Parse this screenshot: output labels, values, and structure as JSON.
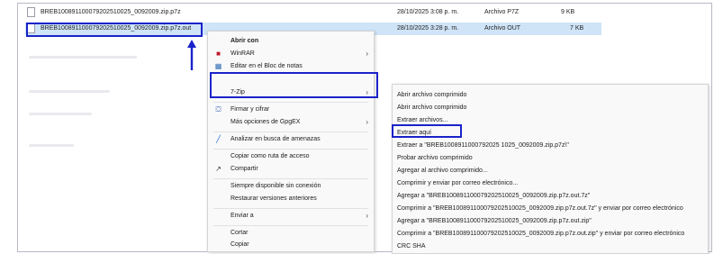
{
  "files": [
    {
      "name": "BREB100891100079202510025_0092009.zip.p7z",
      "date": "28/10/2025 3:08 p. m.",
      "type": "Archivo P7Z",
      "size": "9 KB"
    },
    {
      "name": "BREB100891100079202510025_0092009.zip.p7z.out",
      "date": "28/10/2025 3:28 p. m.",
      "type": "Archivo OUT",
      "size": "7 KB"
    }
  ],
  "context_menu": {
    "open_with": "Abrir con",
    "winrar": "WinRAR",
    "notepad": "Editar en el Bloc de notas",
    "seven_zip": "7-Zip",
    "sign_encrypt": "Firmar y cifrar",
    "gpgex": "Más opciones de GpgEX",
    "scan": "Analizar en busca de amenazas",
    "copy_path": "Copiar como ruta de acceso",
    "share": "Compartir",
    "always_available": "Siempre disponible sin conexión",
    "restore": "Restaurar versiones anteriores",
    "send_to": "Enviar a",
    "cut": "Cortar",
    "copy": "Copiar"
  },
  "submenu": {
    "items": [
      "Abrir archivo comprimido",
      "Abrir archivo comprimido",
      "Extraer archivos...",
      "Extraer aquí",
      "Extraer a \"BREB1008911000792025 1025_0092009.zip.p7z\\\"",
      "Probar archivo comprimido",
      "Agregar al archivo comprimido...",
      "Comprimir y enviar por correo electrónico...",
      "Agregar a \"BREB100891100079202510025_0092009.zip.p7z.out.7z\"",
      "Comprimir a \"BREB100891100079202510025_0092009.zip.p7z.out.7z\" y enviar por correo electrónico",
      "Agregar a \"BREB100891100079202510025_0092009.zip.p7z.out.zip\"",
      "Comprimir a \"BREB100891100079202510025_0092009.zip.p7z.out.zip\" y enviar por correo electrónico",
      "CRC SHA"
    ]
  },
  "icons": {
    "file": "file-icon",
    "winrar": "winrar-icon",
    "notepad": "notepad-icon",
    "shield": "shield-icon",
    "scan": "scan-icon",
    "share": "share-icon",
    "chevron": "chevron-right-icon"
  },
  "colors": {
    "highlight_border": "#1a23c9",
    "selection": "#cfe4f7",
    "arrow": "#1a23c9"
  }
}
